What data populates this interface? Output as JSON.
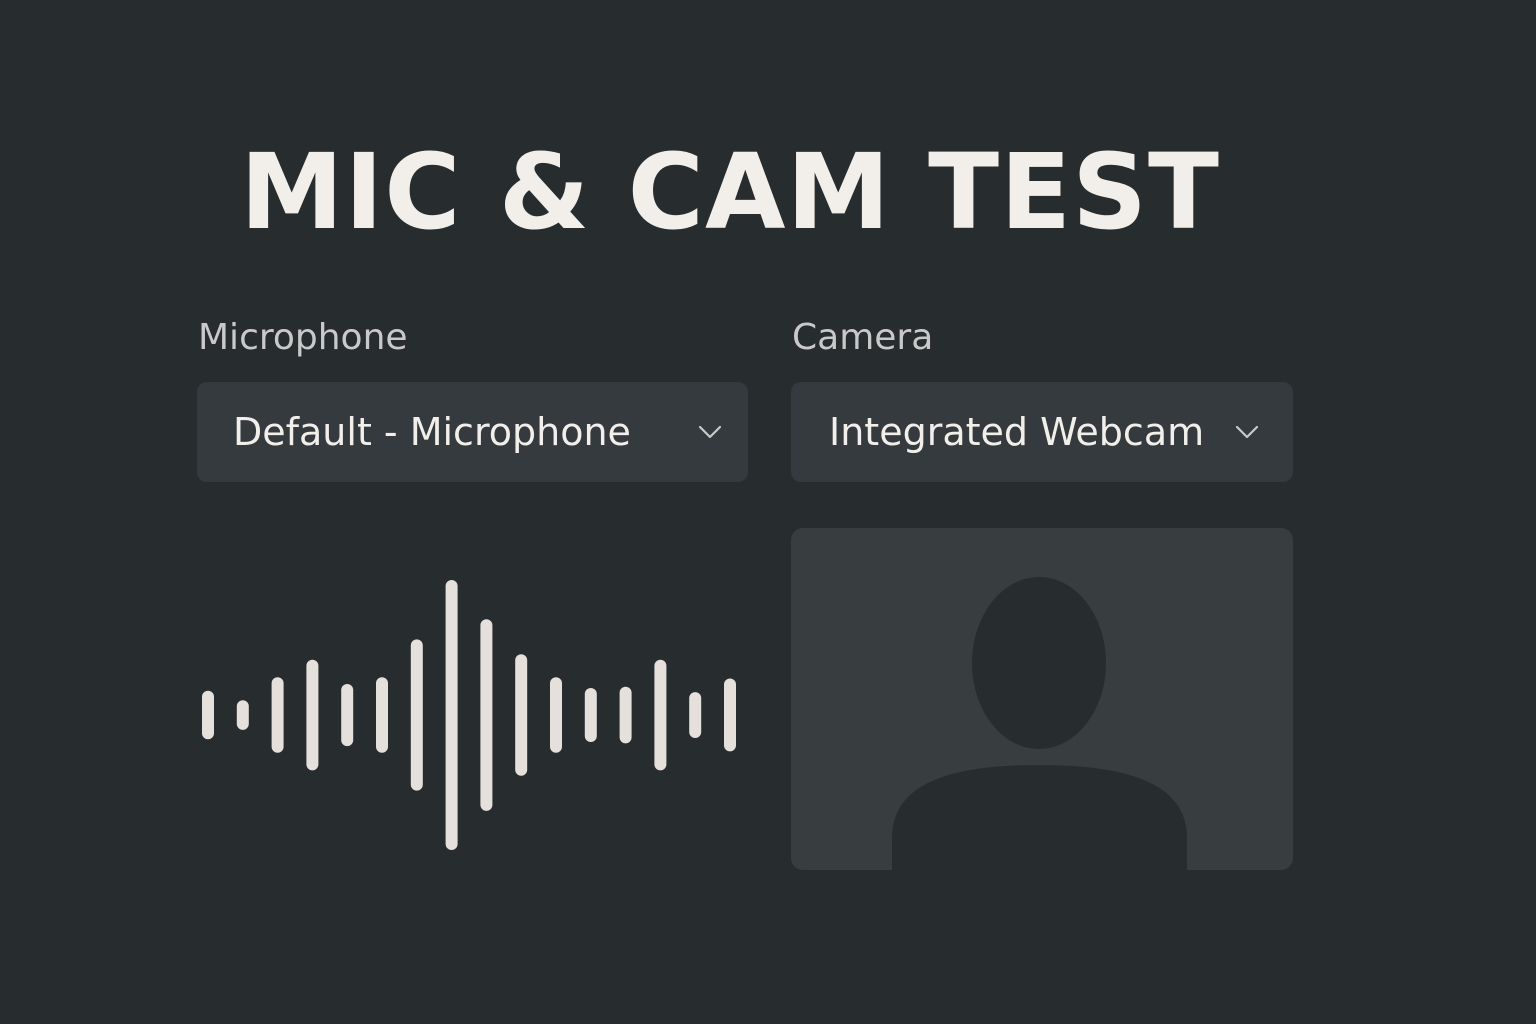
{
  "title": "MIC & CAM TEST",
  "microphone": {
    "label": "Microphone",
    "selected": "Default - Microphone",
    "level_bars": [
      0.18,
      0.11,
      0.28,
      0.41,
      0.23,
      0.28,
      0.56,
      1.0,
      0.71,
      0.45,
      0.28,
      0.2,
      0.21,
      0.41,
      0.17,
      0.27
    ]
  },
  "camera": {
    "label": "Camera",
    "selected": "Integrated Webcam",
    "preview": "person-silhouette-icon"
  },
  "icons": {
    "dropdown": "chevron-down-icon"
  },
  "colors": {
    "background": "#272c2f",
    "surface": "#343a3d",
    "preview_surface": "#383d40",
    "text": "#f2efea",
    "label": "#c8c9c8",
    "wave": "#e6e0dc"
  }
}
